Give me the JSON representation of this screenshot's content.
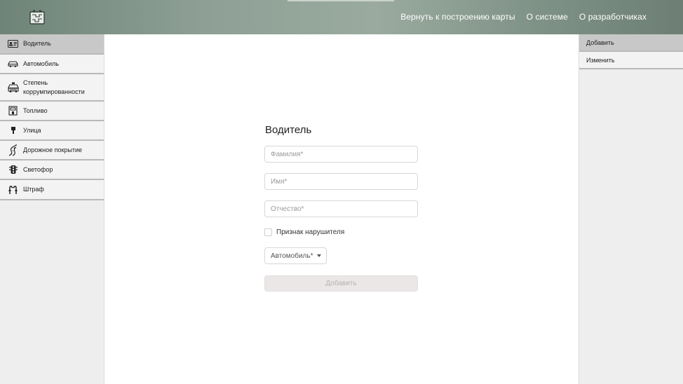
{
  "header": {
    "logo_icon": "map-board-icon",
    "nav": [
      {
        "label": "Вернуть к построению карты"
      },
      {
        "label": "О системе"
      },
      {
        "label": "О разработчиках"
      }
    ]
  },
  "sidebar": {
    "items": [
      {
        "label": "Водитель",
        "icon": "driver-license-icon",
        "active": true
      },
      {
        "label": "Автомобиль",
        "icon": "car-icon",
        "active": false
      },
      {
        "label": "Степень коррумпированности",
        "icon": "police-car-icon",
        "active": false
      },
      {
        "label": "Топливо",
        "icon": "fuel-icon",
        "active": false
      },
      {
        "label": "Улица",
        "icon": "street-sign-icon",
        "active": false
      },
      {
        "label": "Дорожное покрытие",
        "icon": "road-icon",
        "active": false
      },
      {
        "label": "Светофор",
        "icon": "traffic-light-icon",
        "active": false
      },
      {
        "label": "Штраф",
        "icon": "handcuffs-icon",
        "active": false
      }
    ]
  },
  "right_menu": {
    "items": [
      {
        "label": "Добавить",
        "active": true
      },
      {
        "label": "Изменить",
        "active": false
      }
    ]
  },
  "form": {
    "title": "Водитель",
    "last_name": {
      "value": "",
      "placeholder": "Фамилия*"
    },
    "first_name": {
      "value": "",
      "placeholder": "Имя*"
    },
    "patronymic": {
      "value": "",
      "placeholder": "Отчество*"
    },
    "violator_checkbox_label": "Признак нарушителя",
    "violator_checked": false,
    "car_select_label": "Автомобиль*",
    "submit_label": "Добавить"
  },
  "colors": {
    "header_gradient": "#8ea096",
    "active_item": "#c8c8c8",
    "submit_bg": "#ece7e7"
  }
}
